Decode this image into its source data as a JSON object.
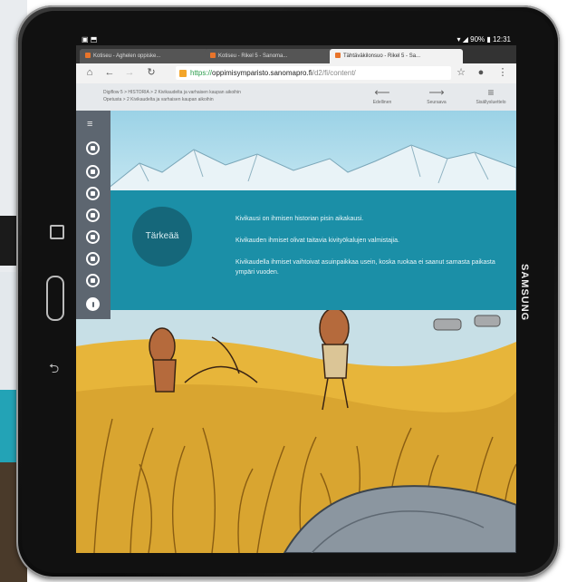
{
  "device": {
    "brand": "SAMSUNG"
  },
  "statusbar": {
    "left": "▣ ⬒",
    "right": "▾ ◢ 90% ▮ 12:31"
  },
  "browser": {
    "tabs": [
      {
        "label": "Kotiseu - Aghelen oppiske..."
      },
      {
        "label": "Kotiseu - Rikel 5 - Sanoma..."
      },
      {
        "label": "Tähtäväkilonsuo - Rikel 5 - Sa..."
      }
    ],
    "url": {
      "protocol": "https://",
      "host": "oppimisymparisto.sanomapro.fi",
      "path": "/d2/fi/content/"
    },
    "icons": {
      "home": "home-icon",
      "back": "arrow-left-icon",
      "forward": "arrow-right-icon",
      "reload": "reload-icon",
      "star": "star-icon",
      "mic": "mic-icon",
      "menu": "kebab-menu-icon"
    }
  },
  "site_header": {
    "breadcrumb_line1": "Digiflow 5 > HISTORIA > 2 Kivikaudelta ja varhaisen kaupan aikoihin",
    "breadcrumb_line2": "Opetusta > 2 Kivikaudelta ja varhaisen kaupan aikoihin",
    "nav": [
      {
        "label": "Edellinen",
        "icon": "arrow-left-icon"
      },
      {
        "label": "Seuraava",
        "icon": "arrow-right-icon"
      },
      {
        "label": "Sisällysluettelo",
        "icon": "menu-icon"
      }
    ]
  },
  "sidebar": {
    "menu_icon": "hamburger-icon",
    "items": [
      {
        "icon": "page-icon"
      },
      {
        "icon": "page-icon"
      },
      {
        "icon": "page-icon"
      },
      {
        "icon": "page-icon"
      },
      {
        "icon": "page-icon"
      },
      {
        "icon": "page-icon"
      },
      {
        "icon": "page-icon"
      },
      {
        "icon": "important-icon"
      }
    ]
  },
  "banner": {
    "badge": "Tärkeää",
    "facts": [
      "Kivikausi on ihmisen historian pisin aikakausi.",
      "Kivikauden ihmiset olivat taitavia kivityökalujen valmistajia.",
      "Kivikaudella ihmiset vaihtoivat asuinpaikkaa usein, koska ruokaa ei saanut samasta paikasta ympäri vuoden."
    ]
  },
  "colors": {
    "banner": "#1b8fa7",
    "badge": "#15677a",
    "sidebar": "#5d6670",
    "sky": "#9bd2e6",
    "grass": "#e7b53a"
  }
}
